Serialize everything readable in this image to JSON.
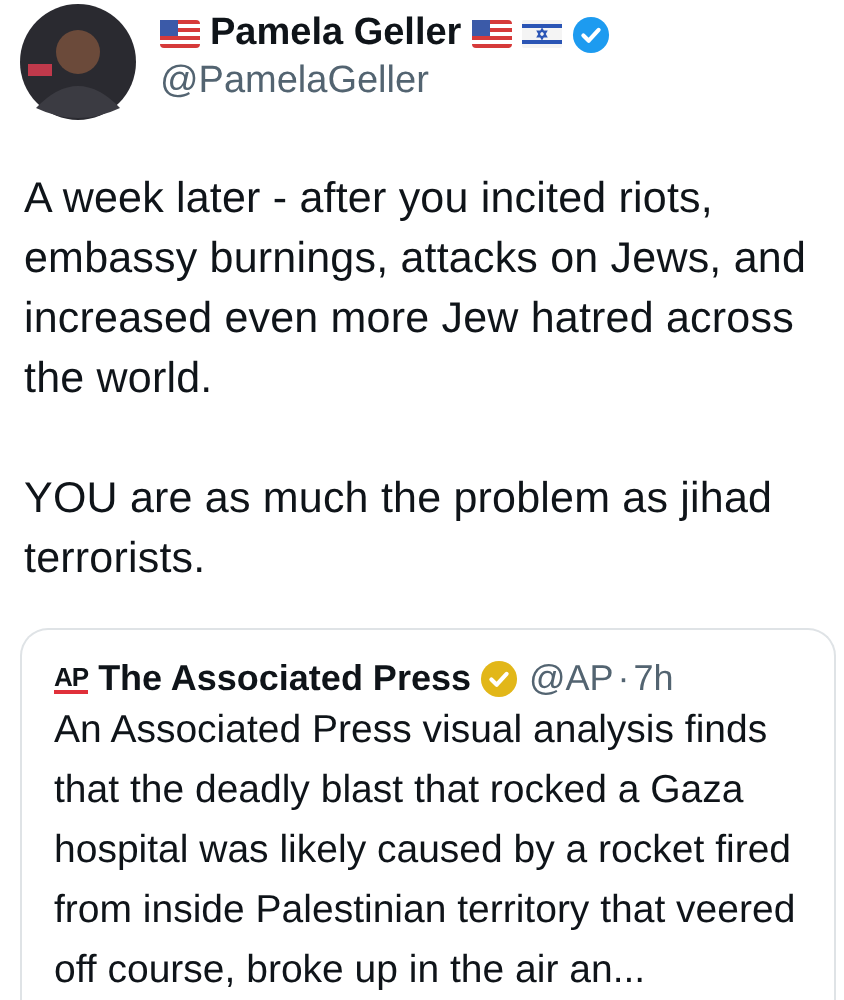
{
  "author": {
    "name": "Pamela Geller",
    "handle": "@PamelaGeller",
    "verified": true
  },
  "paragraphs": [
    "A week later - after you incited riots, embassy burnings, attacks on Jews, and increased even more Jew hatred across the world.",
    "YOU are as much the problem as jihad terrorists."
  ],
  "quote": {
    "logo": "AP",
    "name": "The Associated Press",
    "verified": true,
    "handle": "@AP",
    "separator": "·",
    "time": "7h",
    "text": "An Associated Press visual analysis finds that the deadly blast that rocked a Gaza hospital was likely caused by a rocket fired from inside Palestinian territory that veered off course, broke up in the air an..."
  }
}
